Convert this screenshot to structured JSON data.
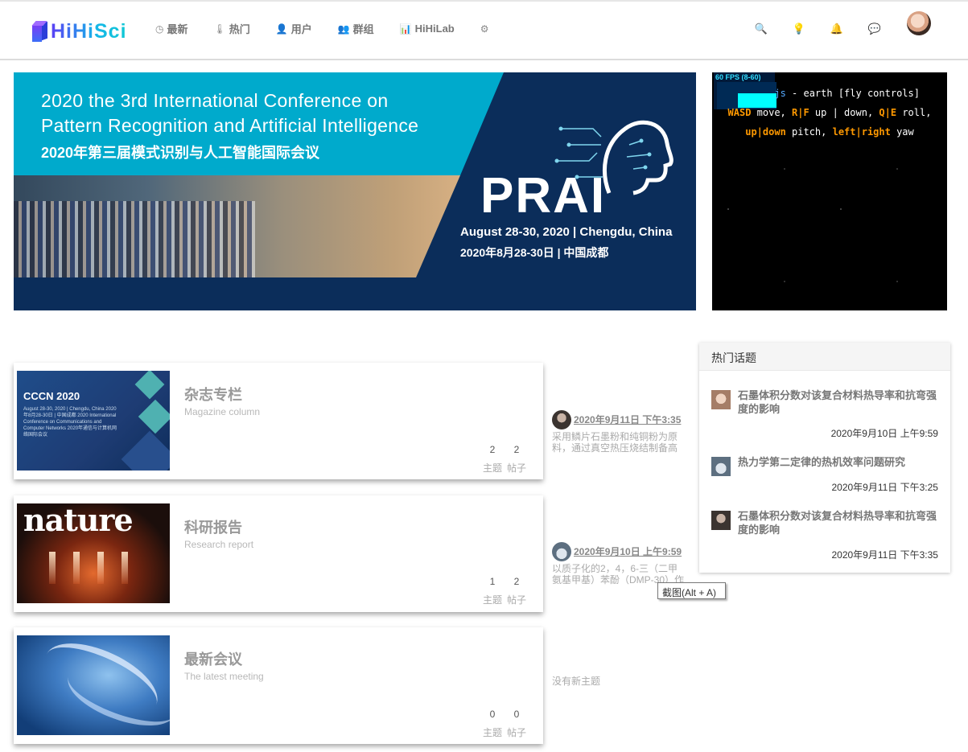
{
  "header": {
    "logo_text": "HiHiSci",
    "nav": [
      {
        "icon": "clock-icon",
        "glyph": "◷",
        "label": "最新"
      },
      {
        "icon": "thermometer-icon",
        "glyph": "🌡",
        "label": "热门"
      },
      {
        "icon": "user-icon",
        "glyph": "👤",
        "label": "用户"
      },
      {
        "icon": "users-icon",
        "glyph": "👥",
        "label": "群组"
      },
      {
        "icon": "bar-chart-icon",
        "glyph": "📊",
        "label": "HiHiLab"
      },
      {
        "icon": "gears-icon",
        "glyph": "⚙",
        "label": ""
      }
    ],
    "right_icons": [
      "search-icon",
      "lightbulb-icon",
      "bell-icon",
      "chat-icon"
    ],
    "right_glyphs": [
      "🔍",
      "💡",
      "🔔",
      "💬"
    ]
  },
  "banner": {
    "title_line1": "2020 the 3rd International Conference on",
    "title_line2": "Pattern Recognition and Artificial Intelligence",
    "title_cn": "2020年第三届模式识别与人工智能国际会议",
    "acronym": "PRAI",
    "date": "August 28-30, 2020 | Chengdu, China",
    "date_cn": "2020年8月28-30日 | 中国成都"
  },
  "space_demo": {
    "fps": "60 FPS (8-60)",
    "line1_link": "js",
    "line1_rest": " - earth [fly controls]",
    "line2_keys1": "WASD",
    "line2_t1": " move, ",
    "line2_keys2": "R|F",
    "line2_t2": " up | down, ",
    "line2_keys3": "Q|E",
    "line2_t3": " roll,",
    "line3_keys1": "up|down",
    "line3_t1": " pitch, ",
    "line3_keys2": "left|right",
    "line3_t2": " yaw"
  },
  "categories": [
    {
      "name": "杂志专栏",
      "subtitle": "Magazine column",
      "image_text": "CCCN 2020",
      "image_subtext": "August 28-30, 2020 | Chengdu, China 2020年8月28-30日 | 中国成都 2020 International Conference on Communications and Computer Networks 2020年通信与计算机网络国际会议",
      "topics": "2",
      "posts": "2",
      "topics_label": "主题",
      "posts_label": "帖子",
      "latest_time": "2020年9月11日 下午3:35",
      "latest_text": "采用鳞片石墨粉和纯铜粉为原料，通过真空热压烧结制备高"
    },
    {
      "name": "科研报告",
      "subtitle": "Research report",
      "image_text": "nature",
      "topics": "1",
      "posts": "2",
      "topics_label": "主题",
      "posts_label": "帖子",
      "latest_time": "2020年9月10日 上午9:59",
      "latest_text": "以质子化的2，4，6-三（二甲氨基甲基）苯酚（DMP-30）作"
    },
    {
      "name": "最新会议",
      "subtitle": "The latest meeting",
      "topics": "0",
      "posts": "0",
      "topics_label": "主题",
      "posts_label": "帖子",
      "latest_none": "没有新主题"
    }
  ],
  "hot_topics": {
    "title": "热门话题",
    "items": [
      {
        "title": "石墨体积分数对该复合材料热导率和抗弯强度的影响",
        "time": "2020年9月10日 上午9:59"
      },
      {
        "title": "热力学第二定律的热机效率问题研究",
        "time": "2020年9月11日 下午3:25"
      },
      {
        "title": "石墨体积分数对该复合材料热导率和抗弯强度的影响",
        "time": "2020年9月11日 下午3:35"
      }
    ]
  },
  "tooltip": "截图(Alt + A)"
}
